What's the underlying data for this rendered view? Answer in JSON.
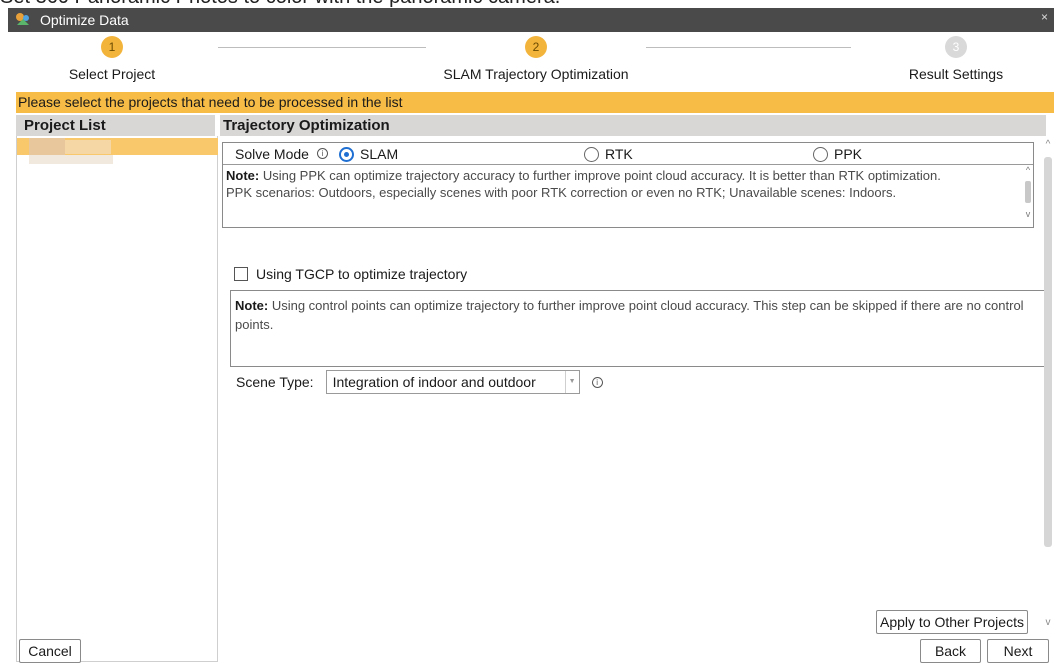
{
  "background_caption": "Set 360 Panoramic Photos to color with the panoramic camera.",
  "window": {
    "title": "Optimize Data",
    "close_glyph": "×"
  },
  "stepper": {
    "steps": [
      {
        "number": "1",
        "label": "Select Project",
        "state": "active"
      },
      {
        "number": "2",
        "label": "SLAM Trajectory Optimization",
        "state": "active"
      },
      {
        "number": "3",
        "label": "Result Settings",
        "state": "inactive"
      }
    ]
  },
  "banner": {
    "text": "Please select the projects that need to be processed in the list"
  },
  "project_list": {
    "header": "Project List"
  },
  "optimization": {
    "header": "Trajectory Optimization",
    "solve_mode": {
      "label": "Solve Mode",
      "options": [
        "SLAM",
        "RTK",
        "PPK"
      ],
      "selected": "SLAM"
    },
    "ppk_note": {
      "prefix": "Note:",
      "line1": " Using PPK can optimize trajectory accuracy to further improve point cloud accuracy. It is better than RTK optimization.",
      "line2": "PPK scenarios: Outdoors, especially scenes with poor RTK correction or even no RTK; Unavailable scenes: Indoors."
    },
    "tgcp": {
      "label": "Using TGCP to optimize trajectory",
      "checked": false
    },
    "tgcp_note": {
      "prefix": "Note:",
      "text": " Using control points can optimize trajectory to further improve point cloud accuracy. This step can be skipped if there are no control points."
    },
    "scene_type": {
      "label": "Scene Type:",
      "value": "Integration of indoor and outdoor"
    }
  },
  "buttons": {
    "apply": "Apply to Other Projects",
    "cancel": "Cancel",
    "back": "Back",
    "next": "Next"
  },
  "colors": {
    "accent": "#f7bc45",
    "radio_selected": "#1f6fd2",
    "titlebar": "#4a4a4a"
  },
  "icons": [
    "app-icon",
    "close-icon",
    "info-icon",
    "chevron-down-icon"
  ]
}
